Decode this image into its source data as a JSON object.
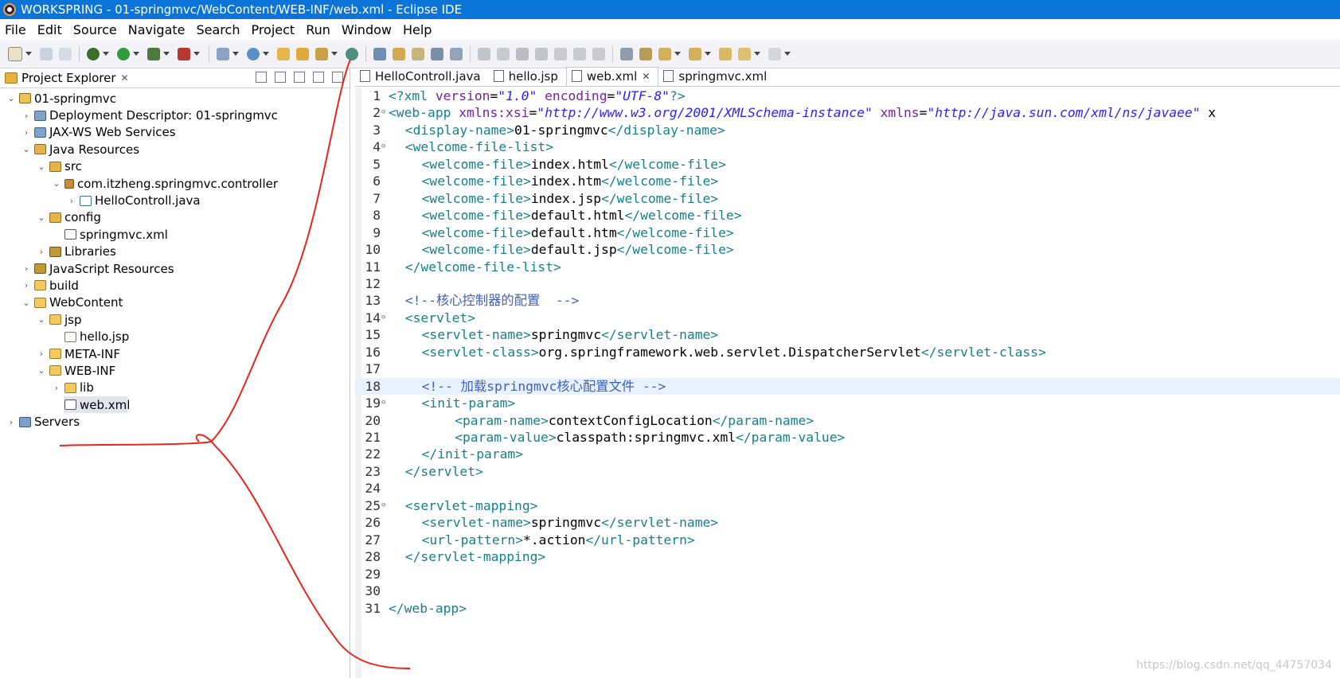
{
  "window": {
    "title": "WORKSPRING - 01-springmvc/WebContent/WEB-INF/web.xml - Eclipse IDE"
  },
  "menu": [
    "File",
    "Edit",
    "Source",
    "Navigate",
    "Search",
    "Project",
    "Run",
    "Window",
    "Help"
  ],
  "project_explorer": {
    "title": "Project Explorer",
    "items": [
      {
        "label": "01-springmvc",
        "icon": "project-icon",
        "depth": 0,
        "expanded": true
      },
      {
        "label": "Deployment Descriptor: 01-springmvc",
        "icon": "deployment-descriptor-icon",
        "depth": 1,
        "expanded": false
      },
      {
        "label": "JAX-WS Web Services",
        "icon": "web-services-icon",
        "depth": 1,
        "expanded": false
      },
      {
        "label": "Java Resources",
        "icon": "java-resources-icon",
        "depth": 1,
        "expanded": true
      },
      {
        "label": "src",
        "icon": "source-folder-icon",
        "depth": 2,
        "expanded": true
      },
      {
        "label": "com.itzheng.springmvc.controller",
        "icon": "package-icon",
        "depth": 3,
        "expanded": true
      },
      {
        "label": "HelloControll.java",
        "icon": "java-file-icon",
        "depth": 4,
        "expanded": false
      },
      {
        "label": "config",
        "icon": "source-folder-icon",
        "depth": 2,
        "expanded": true
      },
      {
        "label": "springmvc.xml",
        "icon": "xml-file-icon",
        "depth": 3,
        "expanded": null
      },
      {
        "label": "Libraries",
        "icon": "libraries-icon",
        "depth": 2,
        "expanded": false
      },
      {
        "label": "JavaScript Resources",
        "icon": "javascript-resources-icon",
        "depth": 1,
        "expanded": false
      },
      {
        "label": "build",
        "icon": "folder-icon",
        "depth": 1,
        "expanded": false
      },
      {
        "label": "WebContent",
        "icon": "folder-icon",
        "depth": 1,
        "expanded": true
      },
      {
        "label": "jsp",
        "icon": "folder-icon",
        "depth": 2,
        "expanded": true
      },
      {
        "label": "hello.jsp",
        "icon": "jsp-file-icon",
        "depth": 3,
        "expanded": null
      },
      {
        "label": "META-INF",
        "icon": "folder-icon",
        "depth": 2,
        "expanded": false
      },
      {
        "label": "WEB-INF",
        "icon": "folder-icon",
        "depth": 2,
        "expanded": true
      },
      {
        "label": "lib",
        "icon": "folder-icon",
        "depth": 3,
        "expanded": false
      },
      {
        "label": "web.xml",
        "icon": "xml-file-icon",
        "depth": 3,
        "expanded": null,
        "selected": true
      },
      {
        "label": "Servers",
        "icon": "servers-icon",
        "depth": 0,
        "expanded": false
      }
    ]
  },
  "editor": {
    "tabs": [
      {
        "label": "HelloControll.java",
        "active": false
      },
      {
        "label": "hello.jsp",
        "active": false
      },
      {
        "label": "web.xml",
        "active": true
      },
      {
        "label": "springmvc.xml",
        "active": false
      }
    ],
    "lines": [
      {
        "n": "1",
        "fold": false,
        "indent": 0,
        "tokens": [
          [
            "pi",
            "<?xml "
          ],
          [
            "attr",
            "version"
          ],
          [
            "text",
            "="
          ],
          [
            "val",
            "\"1.0\""
          ],
          [
            "text",
            " "
          ],
          [
            "attr",
            "encoding"
          ],
          [
            "text",
            "="
          ],
          [
            "val",
            "\"UTF-8\""
          ],
          [
            "pi",
            "?>"
          ]
        ]
      },
      {
        "n": "2",
        "fold": true,
        "indent": 0,
        "tokens": [
          [
            "tag",
            "<web-app "
          ],
          [
            "attr",
            "xmlns:xsi"
          ],
          [
            "text",
            "="
          ],
          [
            "val",
            "\"http://www.w3.org/2001/XMLSchema-instance\""
          ],
          [
            "text",
            " "
          ],
          [
            "attr",
            "xmlns"
          ],
          [
            "text",
            "="
          ],
          [
            "val",
            "\"http://java.sun.com/xml/ns/javaee\""
          ],
          [
            "text",
            " x"
          ]
        ]
      },
      {
        "n": "3",
        "fold": false,
        "indent": 1,
        "tokens": [
          [
            "tag",
            "<display-name>"
          ],
          [
            "text",
            "01-springmvc"
          ],
          [
            "tag",
            "</display-name>"
          ]
        ]
      },
      {
        "n": "4",
        "fold": true,
        "indent": 1,
        "tokens": [
          [
            "tag",
            "<welcome-file-list>"
          ]
        ]
      },
      {
        "n": "5",
        "fold": false,
        "indent": 2,
        "tokens": [
          [
            "tag",
            "<welcome-file>"
          ],
          [
            "text",
            "index.html"
          ],
          [
            "tag",
            "</welcome-file>"
          ]
        ]
      },
      {
        "n": "6",
        "fold": false,
        "indent": 2,
        "tokens": [
          [
            "tag",
            "<welcome-file>"
          ],
          [
            "text",
            "index.htm"
          ],
          [
            "tag",
            "</welcome-file>"
          ]
        ]
      },
      {
        "n": "7",
        "fold": false,
        "indent": 2,
        "tokens": [
          [
            "tag",
            "<welcome-file>"
          ],
          [
            "text",
            "index.jsp"
          ],
          [
            "tag",
            "</welcome-file>"
          ]
        ]
      },
      {
        "n": "8",
        "fold": false,
        "indent": 2,
        "tokens": [
          [
            "tag",
            "<welcome-file>"
          ],
          [
            "text",
            "default.html"
          ],
          [
            "tag",
            "</welcome-file>"
          ]
        ]
      },
      {
        "n": "9",
        "fold": false,
        "indent": 2,
        "tokens": [
          [
            "tag",
            "<welcome-file>"
          ],
          [
            "text",
            "default.htm"
          ],
          [
            "tag",
            "</welcome-file>"
          ]
        ]
      },
      {
        "n": "10",
        "fold": false,
        "indent": 2,
        "tokens": [
          [
            "tag",
            "<welcome-file>"
          ],
          [
            "text",
            "default.jsp"
          ],
          [
            "tag",
            "</welcome-file>"
          ]
        ]
      },
      {
        "n": "11",
        "fold": false,
        "indent": 1,
        "tokens": [
          [
            "tag",
            "</welcome-file-list>"
          ]
        ]
      },
      {
        "n": "12",
        "fold": false,
        "indent": 0,
        "tokens": []
      },
      {
        "n": "13",
        "fold": false,
        "indent": 1,
        "tokens": [
          [
            "comment",
            "<!--核心控制器的配置  -->"
          ]
        ]
      },
      {
        "n": "14",
        "fold": true,
        "indent": 1,
        "tokens": [
          [
            "tag",
            "<servlet>"
          ]
        ]
      },
      {
        "n": "15",
        "fold": false,
        "indent": 2,
        "tokens": [
          [
            "tag",
            "<servlet-name>"
          ],
          [
            "text",
            "springmvc"
          ],
          [
            "tag",
            "</servlet-name>"
          ]
        ]
      },
      {
        "n": "16",
        "fold": false,
        "indent": 2,
        "tokens": [
          [
            "tag",
            "<servlet-class>"
          ],
          [
            "text",
            "org.springframework.web.servlet.DispatcherServlet"
          ],
          [
            "tag",
            "</servlet-class>"
          ]
        ]
      },
      {
        "n": "17",
        "fold": false,
        "indent": 0,
        "tokens": []
      },
      {
        "n": "18",
        "fold": false,
        "indent": 2,
        "current": true,
        "tokens": [
          [
            "comment",
            "<!-- 加载springmvc核心配置文件 -->"
          ]
        ]
      },
      {
        "n": "19",
        "fold": true,
        "indent": 2,
        "tokens": [
          [
            "tag",
            "<init-param>"
          ]
        ]
      },
      {
        "n": "20",
        "fold": false,
        "indent": 4,
        "tokens": [
          [
            "tag",
            "<param-name>"
          ],
          [
            "text",
            "contextConfigLocation"
          ],
          [
            "tag",
            "</param-name>"
          ]
        ]
      },
      {
        "n": "21",
        "fold": false,
        "indent": 4,
        "tokens": [
          [
            "tag",
            "<param-value>"
          ],
          [
            "text",
            "classpath:springmvc.xml"
          ],
          [
            "tag",
            "</param-value>"
          ]
        ]
      },
      {
        "n": "22",
        "fold": false,
        "indent": 2,
        "tokens": [
          [
            "tag",
            "</init-param>"
          ]
        ]
      },
      {
        "n": "23",
        "fold": false,
        "indent": 1,
        "tokens": [
          [
            "tag",
            "</servlet>"
          ]
        ]
      },
      {
        "n": "24",
        "fold": false,
        "indent": 0,
        "tokens": []
      },
      {
        "n": "25",
        "fold": true,
        "indent": 1,
        "tokens": [
          [
            "tag",
            "<servlet-mapping>"
          ]
        ]
      },
      {
        "n": "26",
        "fold": false,
        "indent": 2,
        "tokens": [
          [
            "tag",
            "<servlet-name>"
          ],
          [
            "text",
            "springmvc"
          ],
          [
            "tag",
            "</servlet-name>"
          ]
        ]
      },
      {
        "n": "27",
        "fold": false,
        "indent": 2,
        "tokens": [
          [
            "tag",
            "<url-pattern>"
          ],
          [
            "text",
            "*.action"
          ],
          [
            "tag",
            "</url-pattern>"
          ]
        ]
      },
      {
        "n": "28",
        "fold": false,
        "indent": 1,
        "tokens": [
          [
            "tag",
            "</servlet-mapping>"
          ]
        ]
      },
      {
        "n": "29",
        "fold": false,
        "indent": 0,
        "tokens": []
      },
      {
        "n": "30",
        "fold": false,
        "indent": 0,
        "tokens": []
      },
      {
        "n": "31",
        "fold": false,
        "indent": 0,
        "tokens": [
          [
            "tag",
            "</web-app>"
          ]
        ]
      }
    ]
  },
  "watermark": "https://blog.csdn.net/qq_44757034",
  "colors": {
    "titlebar": "#0a74d8",
    "annotation": "#e8261e",
    "tag": "#17808a",
    "attr": "#7a1fa2",
    "value": "#2a1fff",
    "comment": "#3f5fbf"
  }
}
